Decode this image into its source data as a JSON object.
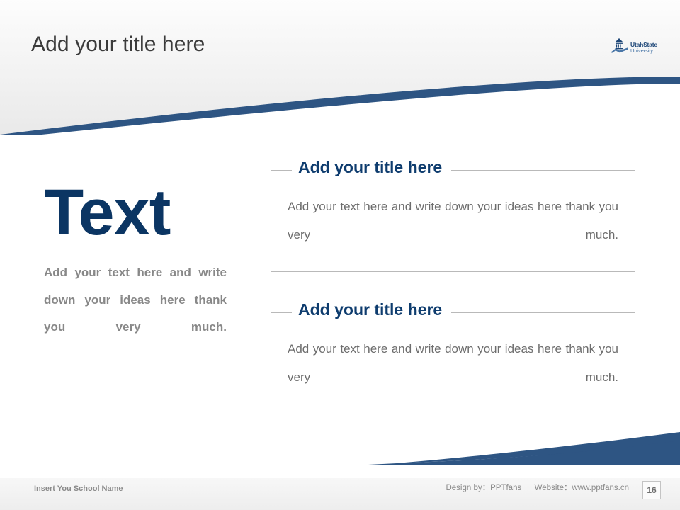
{
  "slide": {
    "title": "Add your title here",
    "page_number": "16",
    "accent_blue": "#2e5583",
    "deep_navy": "#0b3563",
    "title_blue": "#0e3c6e",
    "body_gray": "#6d6d6d",
    "left_body_gray": "#888888"
  },
  "logo": {
    "name": "utah-state-university-logo",
    "line1": "UtahState",
    "line2": "University"
  },
  "left": {
    "heading": "Text",
    "body": "Add your text here and write down your ideas here thank you very much."
  },
  "boxes": [
    {
      "title": "Add your title here",
      "body": "Add your text here and write down your ideas here thank you very much."
    },
    {
      "title": "Add your title here",
      "body": "Add your text here and write down your ideas here thank you very much."
    }
  ],
  "footer": {
    "school_name": "Insert You School Name",
    "design_by": "Design by：PPTfans",
    "website": "Website：www.pptfans.cn"
  }
}
